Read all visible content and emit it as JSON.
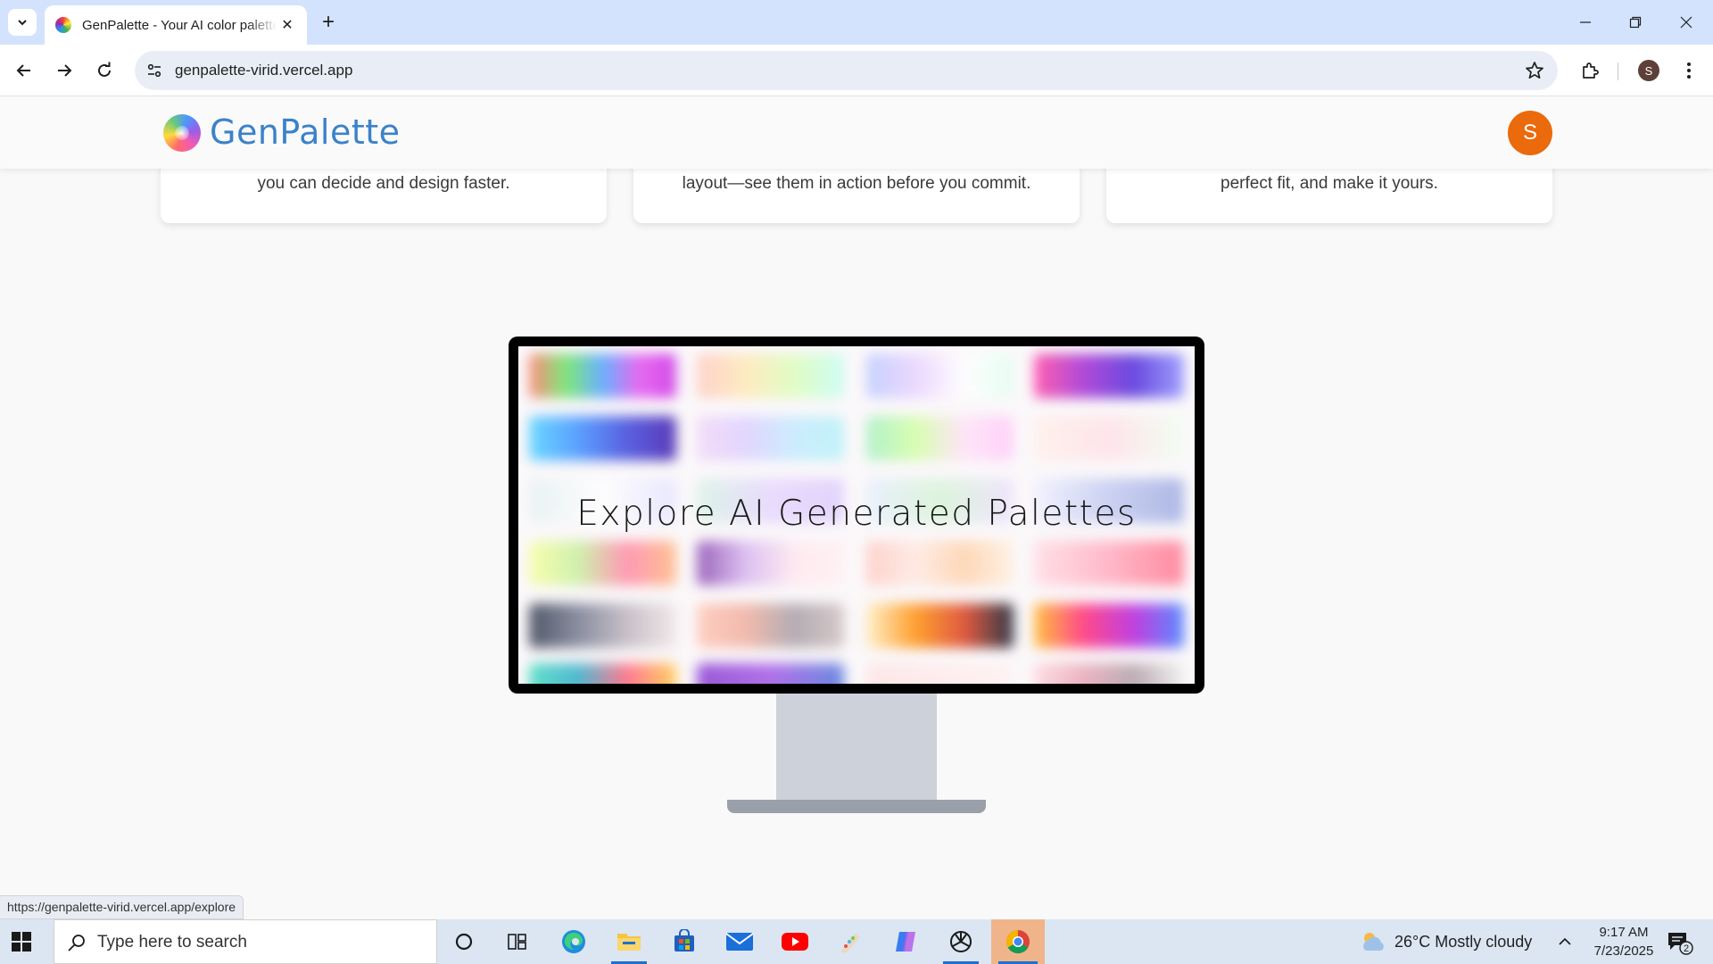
{
  "browser": {
    "tab_title": "GenPalette - Your AI color palette",
    "url": "genpalette-virid.vercel.app",
    "profile_initial": "S"
  },
  "site": {
    "brand": "GenPalette",
    "user_initial": "S",
    "feature_cards": [
      {
        "text": "you can decide and design faster."
      },
      {
        "text": "layout—see them in action before you commit."
      },
      {
        "text": "perfect fit, and make it yours."
      }
    ],
    "hero_title": "Explore AI Generated Palettes",
    "link_preview": "https://genpalette-virid.vercel.app/explore"
  },
  "taskbar": {
    "search_placeholder": "Type here to search",
    "weather": "26°C  Mostly cloudy",
    "time": "9:17 AM",
    "date": "7/23/2025",
    "notification_count": "2",
    "apps": [
      "cortana-icon",
      "task-view-icon",
      "edge-icon",
      "file-explorer-icon",
      "store-icon",
      "mail-icon",
      "youtube-icon",
      "paint-icon",
      "copilot-icon",
      "chatgpt-icon",
      "chrome-icon"
    ]
  },
  "colors": {
    "brand_blue": "#3b82c9",
    "avatar_orange": "#ea6a0c",
    "tab_strip": "#d3e3fd"
  }
}
